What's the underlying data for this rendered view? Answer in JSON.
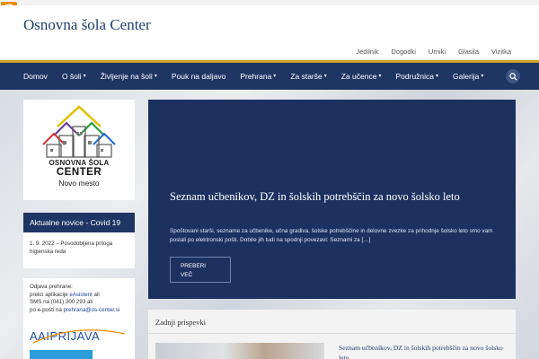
{
  "site": {
    "title": "Osnovna šola Center"
  },
  "top_nav": [
    "Jedilnik",
    "Dogodki",
    "Urniki",
    "Glasila",
    "Vizitka"
  ],
  "main_nav": [
    {
      "label": "Domov",
      "dropdown": false
    },
    {
      "label": "O šoli",
      "dropdown": true
    },
    {
      "label": "Življenje na šoli",
      "dropdown": true
    },
    {
      "label": "Pouk na daljavo",
      "dropdown": false
    },
    {
      "label": "Prehrana",
      "dropdown": true
    },
    {
      "label": "Za starše",
      "dropdown": true
    },
    {
      "label": "Za učence",
      "dropdown": true
    },
    {
      "label": "Podružnica",
      "dropdown": true
    },
    {
      "label": "Galerija",
      "dropdown": true
    }
  ],
  "icons": {
    "accessibility": "accessibility-icon",
    "search": "search-icon",
    "caret": "chevron-down-icon"
  },
  "colors": {
    "primary": "#1f3563",
    "accent": "#c8a62a",
    "a11y": "#f28c00"
  },
  "logo": {
    "line1": "OSNOVNA ŠOLA",
    "line2": "CENTER",
    "line3": "Novo mesto"
  },
  "sidebar": {
    "news_title": "Aktualne novice - Covid 19",
    "news_item": "1. 9. 2022 – Posodobljena priloga higienska reda",
    "info": {
      "l1": "Odjava prehrane:",
      "l2a": "preko aplikacije ",
      "l2b": "eAsistent",
      "l2c": " ali",
      "l3": "SMS na (041) 300 293 ali",
      "l4a": "po e-pošti na ",
      "l4b": "prehrana@os-center.si"
    },
    "aai": "AAIPRIJAVA"
  },
  "hero": {
    "title": "Seznam učbenikov, DZ in šolskih potrebščin za novo šolsko leto",
    "excerpt": "Spoštovani starši, sezname za učbenike, učna gradiva, šolske potrebščine in delovne zvezke za prihodnje šolsko leto smo vam poslali po elektronski pošti. Dobite jih tudi na spodnji povezavi: Seznami za […]",
    "button_line1": "PREBERI",
    "button_line2": "VEČ"
  },
  "latest": {
    "heading": "Zadnji prispevki",
    "post_title": "Seznam učbenikov, DZ in šolskih potrebščin za novo šolsko leto"
  }
}
